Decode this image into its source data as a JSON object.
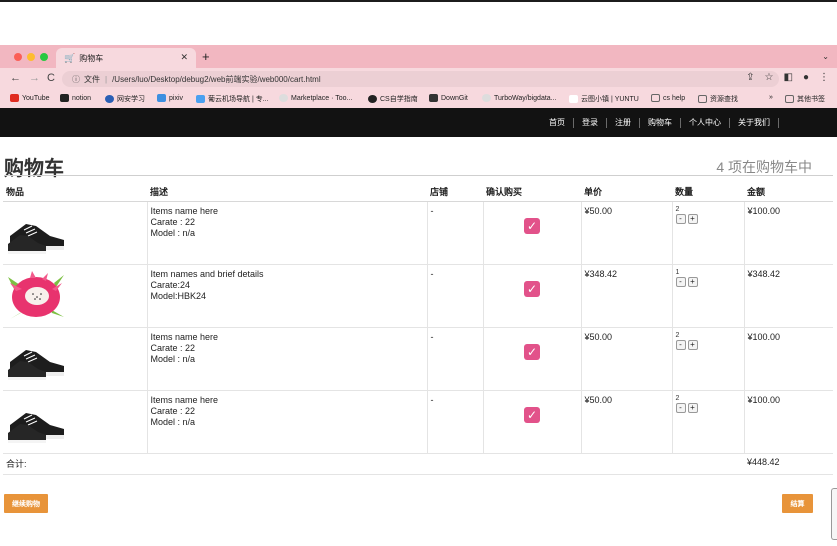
{
  "browser": {
    "tab_title": "购物车",
    "address": {
      "scheme_label": "文件",
      "path": "/Users/luo/Desktop/debug2/web前端实验/web000/cart.html"
    },
    "bookmarks": [
      {
        "label": "YouTube",
        "color": "#e02b20"
      },
      {
        "label": "notion",
        "color": "#222222"
      },
      {
        "label": "网安学习",
        "color": "#2a5fb5"
      },
      {
        "label": "pixiv",
        "color": "#3d8fe0"
      },
      {
        "label": "葡云机场导航 | 专...",
        "color": "#4aa0f0"
      },
      {
        "label": "Marketplace · Too...",
        "color": "#dddddd"
      },
      {
        "label": "CS自学指南",
        "color": "#222222"
      },
      {
        "label": "DownGit",
        "color": "#333333"
      },
      {
        "label": "TurboWay/bigdata...",
        "color": "#dddddd"
      },
      {
        "label": "云图小镇 | YUNTU",
        "color": "#ffffff"
      },
      {
        "label": "cs help",
        "color": "#666666"
      },
      {
        "label": "资源查找",
        "color": "#666666"
      }
    ],
    "bookmarks_overflow": "»",
    "other_bookmarks": "其他书签"
  },
  "site_nav": [
    "首页",
    "登录",
    "注册",
    "购物车",
    "个人中心",
    "关于我们"
  ],
  "page": {
    "title": "购物车",
    "count_text": "4 项在购物车中"
  },
  "table": {
    "headers": [
      "物品",
      "描述",
      "店铺",
      "确认购买",
      "单价",
      "数量",
      "金额"
    ],
    "rows": [
      {
        "image": "sneaker-icon",
        "desc": [
          "Items name here",
          "Carate : 22",
          "Model : n/a"
        ],
        "shop": "-",
        "checked": true,
        "price": "¥50.00",
        "qty": "2",
        "amount": "¥100.00"
      },
      {
        "image": "dragonfruit-icon",
        "desc": [
          "Item names and brief details",
          "Carate:24",
          "Model:HBK24"
        ],
        "shop": "-",
        "checked": true,
        "price": "¥348.42",
        "qty": "1",
        "amount": "¥348.42"
      },
      {
        "image": "sneaker-icon",
        "desc": [
          "Items name here",
          "Carate : 22",
          "Model : n/a"
        ],
        "shop": "-",
        "checked": true,
        "price": "¥50.00",
        "qty": "2",
        "amount": "¥100.00"
      },
      {
        "image": "sneaker-icon",
        "desc": [
          "Items name here",
          "Carate : 22",
          "Model : n/a"
        ],
        "shop": "-",
        "checked": true,
        "price": "¥50.00",
        "qty": "2",
        "amount": "¥100.00"
      }
    ],
    "stepper_minus": "-",
    "stepper_plus": "+",
    "total_label": "合计:",
    "total_value": "¥448.42"
  },
  "buttons": {
    "continue": "继续购物",
    "checkout": "结算"
  },
  "colors": {
    "chrome": "#f2b7c1",
    "accent_button": "#e8943a",
    "checkbox": "#e2528a",
    "nav_bg": "#121212"
  }
}
